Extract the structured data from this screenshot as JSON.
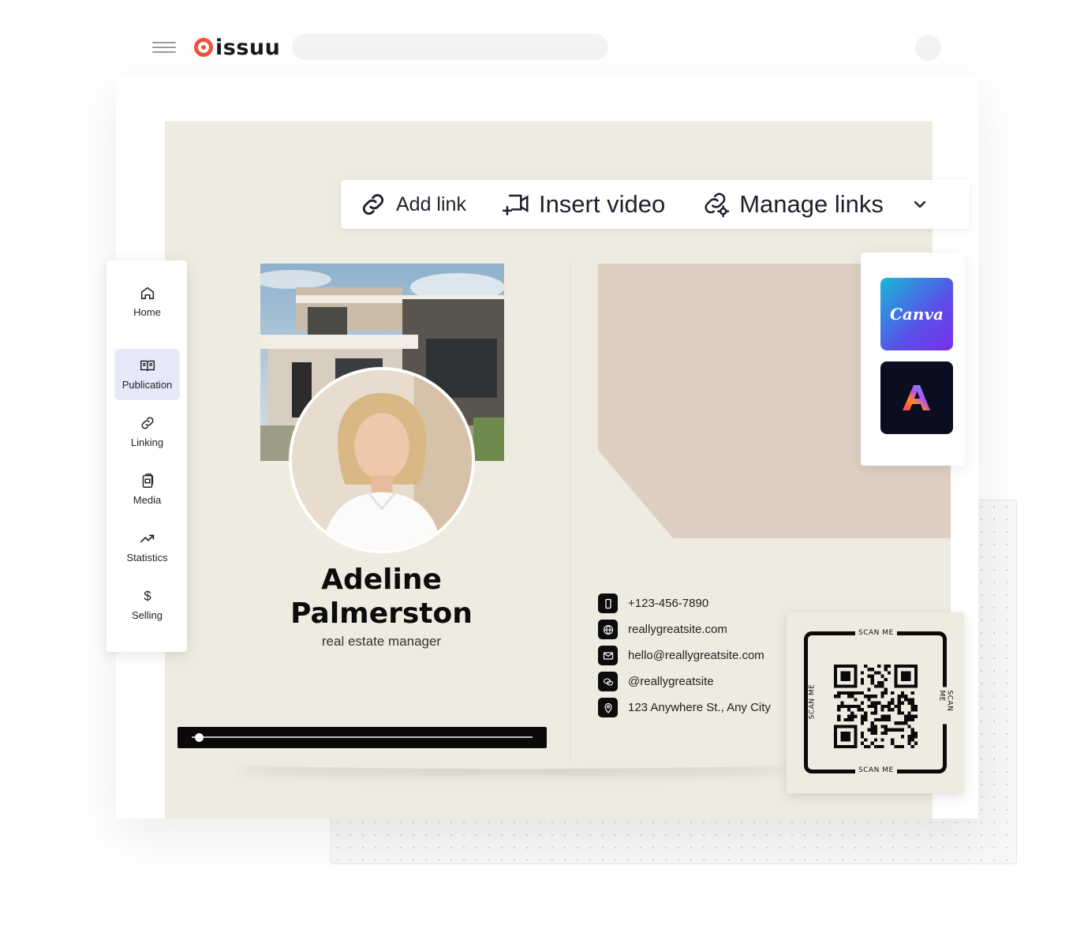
{
  "app": {
    "logo_text": "issuu"
  },
  "toolbar": {
    "add_link": "Add link",
    "insert_video": "Insert video",
    "manage_links": "Manage links"
  },
  "sidebar": {
    "items": [
      {
        "label": "Home",
        "icon": "home-icon"
      },
      {
        "label": "Publication",
        "icon": "book-icon",
        "active": true
      },
      {
        "label": "Linking",
        "icon": "link-icon"
      },
      {
        "label": "Media",
        "icon": "media-icon"
      },
      {
        "label": "Statistics",
        "icon": "trend-icon"
      },
      {
        "label": "Selling",
        "icon": "dollar-icon"
      }
    ]
  },
  "publication": {
    "name_line1": "Adeline",
    "name_line2": "Palmerston",
    "role": "real estate manager",
    "contacts": [
      {
        "icon": "phone-icon",
        "text": "+123-456-7890"
      },
      {
        "icon": "globe-icon",
        "text": "reallygreatsite.com"
      },
      {
        "icon": "mail-icon",
        "text": "hello@reallygreatsite.com"
      },
      {
        "icon": "chat-icon",
        "text": "@reallygreatsite"
      },
      {
        "icon": "pin-icon",
        "text": "123 Anywhere St., Any City"
      }
    ],
    "qr_caption": "SCAN ME",
    "video_progress": 0.02
  },
  "integrations": {
    "canva_label": "Canva"
  },
  "colors": {
    "brand": "#f0513f",
    "page_bg": "#eeebe0",
    "accent_shape": "#ddcfc2",
    "active_nav": "#e8e8fb"
  }
}
